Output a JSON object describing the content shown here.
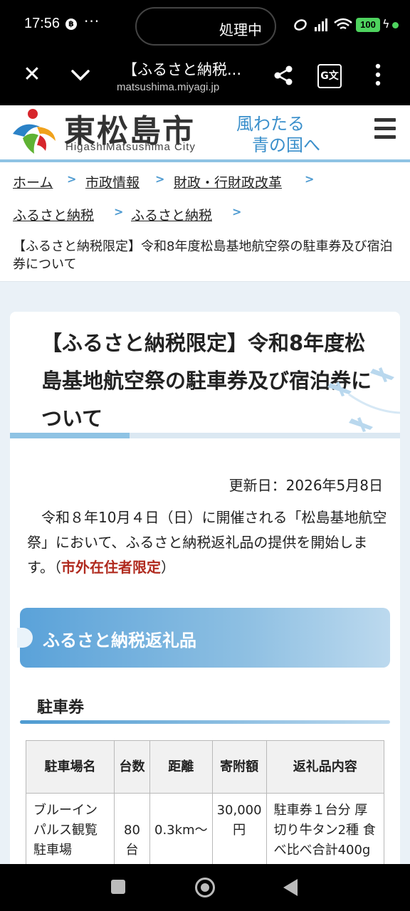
{
  "status_bar": {
    "time": "17:56",
    "dots": "···",
    "processing": "処理中",
    "battery": "100",
    "icons": [
      "b-badge-icon",
      "link-icon",
      "signal-icon",
      "wifi-icon",
      "charging-icon"
    ]
  },
  "browser": {
    "page_title": "【ふるさと納税...",
    "url": "matsushima.miyagi.jp"
  },
  "site_header": {
    "logo_jp": "東松島市",
    "logo_en": "HigashiMatsushima City",
    "slogan_line1": "風わたる",
    "slogan_line2": "青の国へ"
  },
  "breadcrumb": {
    "items": [
      "ホーム",
      "市政情報",
      "財政・行財政改革",
      "ふるさと納税",
      "ふるさと納税"
    ],
    "current": "【ふるさと納税限定】令和8年度松島基地航空祭の駐車券及び宿泊券について"
  },
  "article": {
    "title": "【ふるさと納税限定】令和8年度松島基地航空祭の駐車券及び宿泊券について",
    "updated": "更新日：2026年5月8日",
    "intro_text": "令和８年10月４日（日）に開催される「松島基地航空祭」において、ふるさと納税返礼品の提供を開始します。（",
    "intro_emphasis": "市外在住者限定",
    "intro_close": "）",
    "section_heading": "ふるさと納税返礼品",
    "subsection_heading": "駐車券",
    "table": {
      "headers": [
        "駐車場名",
        "台数",
        "距離",
        "寄附額",
        "返礼品内容"
      ],
      "rows": [
        {
          "name": "ブルーインパルス観覧駐車場",
          "count": "80台",
          "distance": "0.3km〜",
          "donation": "30,000円",
          "content": "駐車券１台分 厚切り牛タン2種 食べ比べ合計400g"
        }
      ]
    }
  },
  "colors": {
    "accent_blue": "#4e9bd1",
    "emphasis_red": "#b02a1e"
  }
}
